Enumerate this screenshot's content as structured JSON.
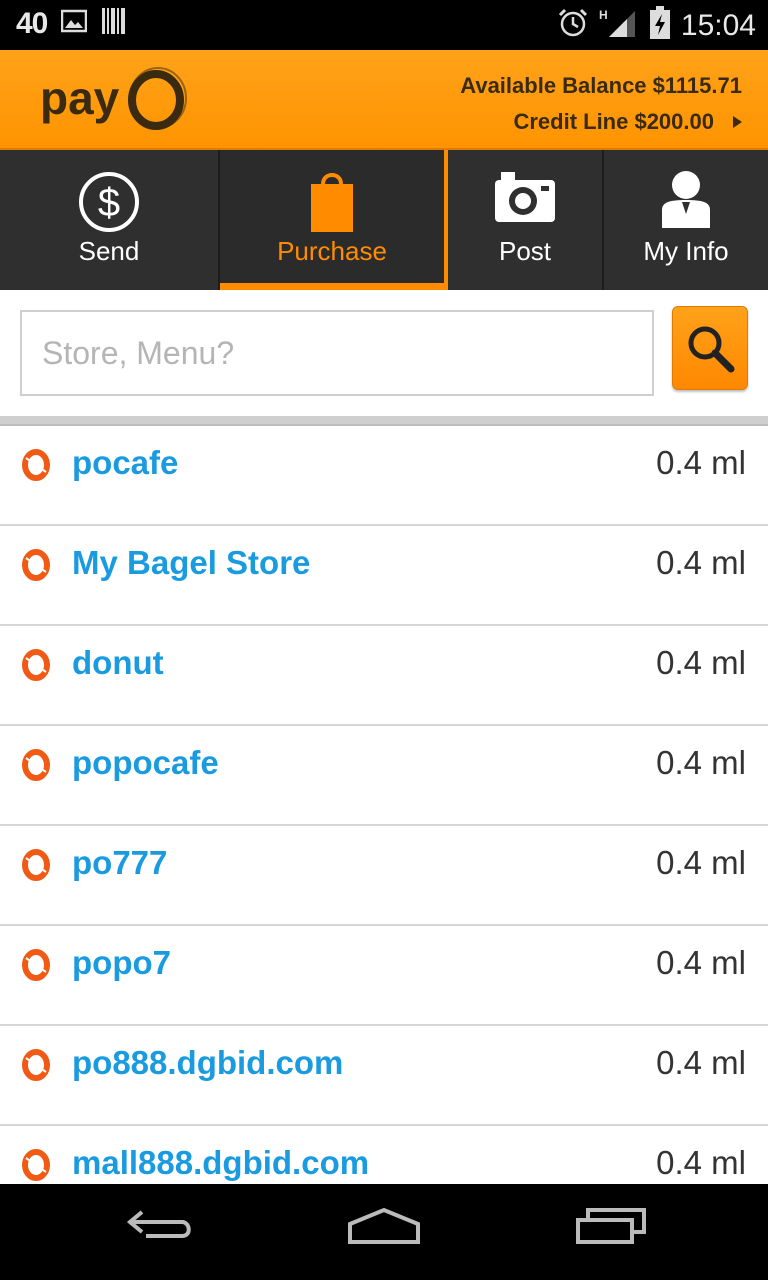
{
  "status_bar": {
    "notification_number": "40",
    "time": "15:04",
    "icons": [
      "image-icon",
      "barcode-icon",
      "alarm-icon",
      "signal-icon",
      "battery-icon"
    ],
    "network_type": "H"
  },
  "header": {
    "logo_text": "payO",
    "available_balance": "Available Balance $1115.71",
    "credit_line": "Credit Line $200.00",
    "accent_color": "#ff9400"
  },
  "tabs": [
    {
      "label": "Send",
      "icon": "dollar-icon",
      "active": false
    },
    {
      "label": "Purchase",
      "icon": "shopping-bag-icon",
      "active": true
    },
    {
      "label": "Post",
      "icon": "camera-icon",
      "active": false
    },
    {
      "label": "My Info",
      "icon": "user-icon",
      "active": false
    }
  ],
  "search": {
    "placeholder": "Store, Menu?",
    "value": ""
  },
  "stores": [
    {
      "name": "pocafe",
      "distance": "0.4 ml"
    },
    {
      "name": "My Bagel Store",
      "distance": "0.4 ml"
    },
    {
      "name": "donut",
      "distance": "0.4 ml"
    },
    {
      "name": "popocafe",
      "distance": "0.4 ml"
    },
    {
      "name": "po777",
      "distance": "0.4 ml"
    },
    {
      "name": "popo7",
      "distance": "0.4 ml"
    },
    {
      "name": "po888.dgbid.com",
      "distance": "0.4 ml"
    },
    {
      "name": "mall888.dgbid.com",
      "distance": "0.4 ml"
    }
  ],
  "nav": [
    "back-icon",
    "home-icon",
    "recents-icon"
  ]
}
